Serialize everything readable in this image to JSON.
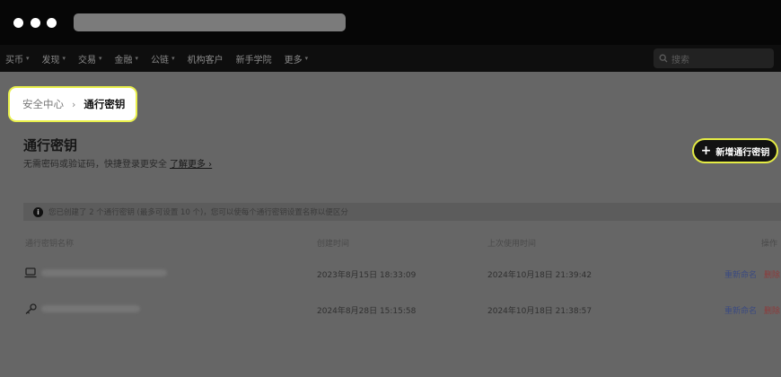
{
  "nav": {
    "items": [
      {
        "label": "买币",
        "has_menu": true
      },
      {
        "label": "发现",
        "has_menu": true
      },
      {
        "label": "交易",
        "has_menu": true
      },
      {
        "label": "金融",
        "has_menu": true
      },
      {
        "label": "公链",
        "has_menu": true
      },
      {
        "label": "机构客户",
        "has_menu": false
      },
      {
        "label": "新手学院",
        "has_menu": false
      },
      {
        "label": "更多",
        "has_menu": true
      }
    ],
    "search_placeholder": "搜索",
    "chevron_glyph": "▾"
  },
  "breadcrumb": {
    "parent": "安全中心",
    "separator": "›",
    "current": "通行密钥"
  },
  "page": {
    "title": "通行密钥",
    "description": "无需密码或验证码，快捷登录更安全",
    "learn_more": "了解更多 ›",
    "add_button": "新增通行密钥",
    "add_glyph": "+"
  },
  "notice": {
    "icon": "i",
    "text": "您已创建了 2 个通行密钥 (最多可设置 10 个)，您可以使每个通行密钥设置名称以便区分"
  },
  "table": {
    "headers": [
      "通行密钥名称",
      "创建时间",
      "上次使用时间",
      "操作"
    ],
    "rows": [
      {
        "device_icon": "laptop-icon",
        "created": "2023年8月15日 18:33:09",
        "last_used": "2024年10月18日 21:39:42",
        "edit": "重新命名",
        "delete": "删除"
      },
      {
        "device_icon": "key-icon",
        "created": "2024年8月28日 15:15:58",
        "last_used": "2024年10月18日 21:38:57",
        "edit": "重新命名",
        "delete": "删除"
      }
    ]
  },
  "colors": {
    "highlight": "#e9f04b",
    "overlay": "#666666",
    "header_bg": "#060606",
    "button_bg": "#121212"
  }
}
